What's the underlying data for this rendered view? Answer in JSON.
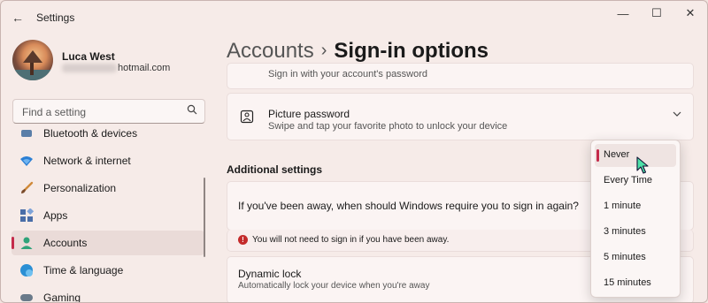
{
  "window": {
    "app_title": "Settings",
    "controls": {
      "minimize": "—",
      "maximize": "☐",
      "close": "✕"
    }
  },
  "profile": {
    "name": "Luca West",
    "email_visible": "hotmail.com"
  },
  "search": {
    "placeholder": "Find a setting",
    "value": ""
  },
  "nav": {
    "items": [
      {
        "label": "Bluetooth & devices",
        "icon": "bluetooth-icon"
      },
      {
        "label": "Network & internet",
        "icon": "wifi-icon"
      },
      {
        "label": "Personalization",
        "icon": "brush-icon"
      },
      {
        "label": "Apps",
        "icon": "apps-icon"
      },
      {
        "label": "Accounts",
        "icon": "person-icon",
        "active": true
      },
      {
        "label": "Time & language",
        "icon": "globe-icon"
      },
      {
        "label": "Gaming",
        "icon": "gamepad-icon"
      }
    ]
  },
  "header": {
    "parent": "Accounts",
    "separator": "›",
    "current": "Sign-in options"
  },
  "partial_card": {
    "desc": "Sign in with your account's password"
  },
  "picture_password": {
    "title": "Picture password",
    "desc": "Swipe and tap your favorite photo to unlock your device",
    "icon": "picture-icon"
  },
  "additional": {
    "section_title": "Additional settings",
    "away_label": "If you've been away, when should Windows require you to sign in again?",
    "warning": "You will not need to sign in if you have been away.",
    "dynamic_lock_title": "Dynamic lock",
    "dynamic_lock_desc": "Automatically lock your device when you're away"
  },
  "dropdown": {
    "selected": "Never",
    "options": [
      "Never",
      "Every Time",
      "1 minute",
      "3 minutes",
      "5 minutes",
      "15 minutes"
    ]
  },
  "colors": {
    "accent": "#c42b4b",
    "background": "#f6ebe8",
    "card": "#fbf4f3"
  }
}
